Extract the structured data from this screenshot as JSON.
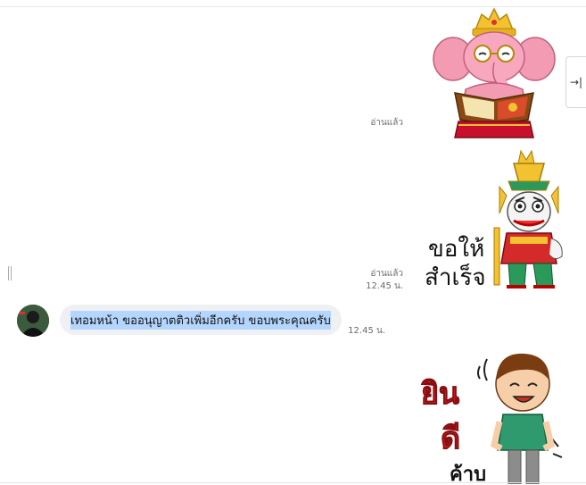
{
  "messages": [
    {
      "type": "sticker",
      "sticker": "ganesha-reading-book",
      "status": "อ่านแล้ว"
    },
    {
      "type": "sticker",
      "sticker": "thai-giant-guardian",
      "sticker_text": [
        "ขอให้",
        "สำเร็จ"
      ],
      "status": "อ่านแล้ว",
      "time": "12.45 น."
    },
    {
      "type": "text",
      "direction": "incoming",
      "text": "เทอมหน้า ขออนุญาตติวเพิ่มอีกครับ ขอบพระคุณครับ",
      "time": "12.45 น.",
      "selected": true
    },
    {
      "type": "sticker",
      "sticker": "boy-welcome",
      "sticker_text": [
        "ยิน",
        "ดี",
        "ค้าบ"
      ]
    }
  ],
  "ui": {
    "side_panel_toggle_icon": "→|"
  },
  "icons": {
    "side_panel_toggle": "arrow-to-right-bar-icon",
    "resize_handle": "double-bar-icon"
  },
  "colors": {
    "bubble_bg": "#eef0f3",
    "selection": "#b4d5fe",
    "meta_text": "#6b6b6b"
  }
}
